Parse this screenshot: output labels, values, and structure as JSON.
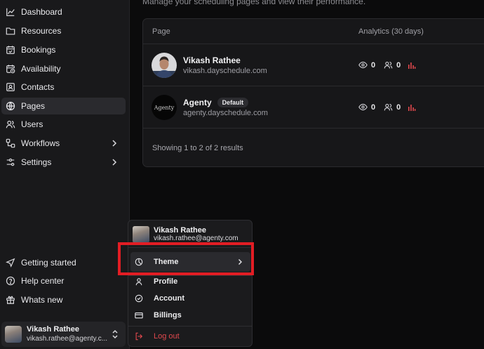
{
  "sidebar": {
    "items": [
      {
        "label": "Dashboard",
        "icon": "chart-line-icon",
        "active": false
      },
      {
        "label": "Resources",
        "icon": "folder-icon",
        "active": false
      },
      {
        "label": "Bookings",
        "icon": "calendar-check-icon",
        "active": false
      },
      {
        "label": "Availability",
        "icon": "calendar-clock-icon",
        "active": false
      },
      {
        "label": "Contacts",
        "icon": "contact-card-icon",
        "active": false
      },
      {
        "label": "Pages",
        "icon": "globe-icon",
        "active": true
      },
      {
        "label": "Users",
        "icon": "users-icon",
        "active": false
      },
      {
        "label": "Workflows",
        "icon": "workflow-icon",
        "active": false,
        "expandable": true
      },
      {
        "label": "Settings",
        "icon": "sliders-icon",
        "active": false,
        "expandable": true
      }
    ],
    "bottom_items": [
      {
        "label": "Getting started",
        "icon": "navigation-arrow-icon"
      },
      {
        "label": "Help center",
        "icon": "help-circle-icon"
      },
      {
        "label": "Whats new",
        "icon": "gift-icon"
      }
    ],
    "user": {
      "name": "Vikash Rathee",
      "email": "vikash.rathee@agenty.c..."
    }
  },
  "main": {
    "subtitle": "Manage your scheduling pages and view their performance.",
    "table": {
      "col_page": "Page",
      "col_analytics": "Analytics (30 days)",
      "rows": [
        {
          "name": "Vikash Rathee",
          "url": "vikash.dayschedule.com",
          "badge": "",
          "views": "0",
          "visitors": "0"
        },
        {
          "name": "Agenty",
          "url": "agenty.dayschedule.com",
          "badge": "Default",
          "views": "0",
          "visitors": "0",
          "logo_text": "Agenty"
        }
      ],
      "footer": "Showing 1 to 2 of 2 results"
    }
  },
  "dropdown": {
    "user": {
      "name": "Vikash Rathee",
      "email": "vikash.rathee@agenty.com"
    },
    "theme_label": "Theme",
    "profile_label": "Profile",
    "account_label": "Account",
    "billings_label": "Billings",
    "logout_label": "Log out"
  },
  "colors": {
    "highlight": "#e21d24",
    "logout": "#e0484d",
    "analytics_bars": "#e0484d"
  }
}
